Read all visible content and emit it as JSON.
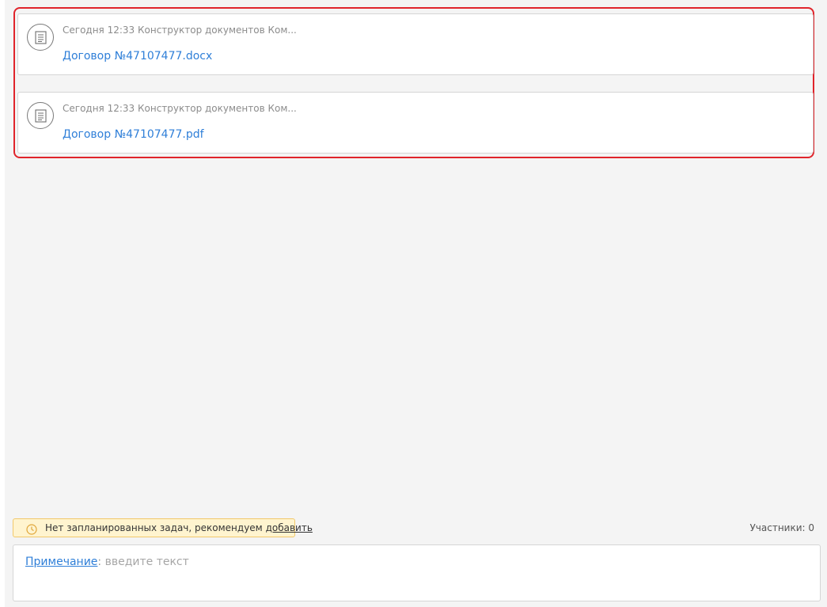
{
  "documents": [
    {
      "meta": "Сегодня 12:33 Конструктор документов Ком...",
      "file_name": "Договор №47107477.docx",
      "icon": "document-icon"
    },
    {
      "meta": "Сегодня 12:33 Конструктор документов Ком...",
      "file_name": "Договор №47107477.pdf",
      "icon": "document-icon"
    }
  ],
  "tasks": {
    "text": "Нет запланированных задач, рекомендуем ",
    "add_label": "добавить",
    "icon": "clock-icon"
  },
  "participants": {
    "label": "Участники: 0"
  },
  "note": {
    "label": "Примечание",
    "separator": ": ",
    "placeholder": "введите текст"
  },
  "colors": {
    "highlight": "#e0242b",
    "link": "#2f7fd8",
    "task_bg": "#fff4cf",
    "task_border": "#f1c86b",
    "feed_bg": "#f4f4f4"
  }
}
